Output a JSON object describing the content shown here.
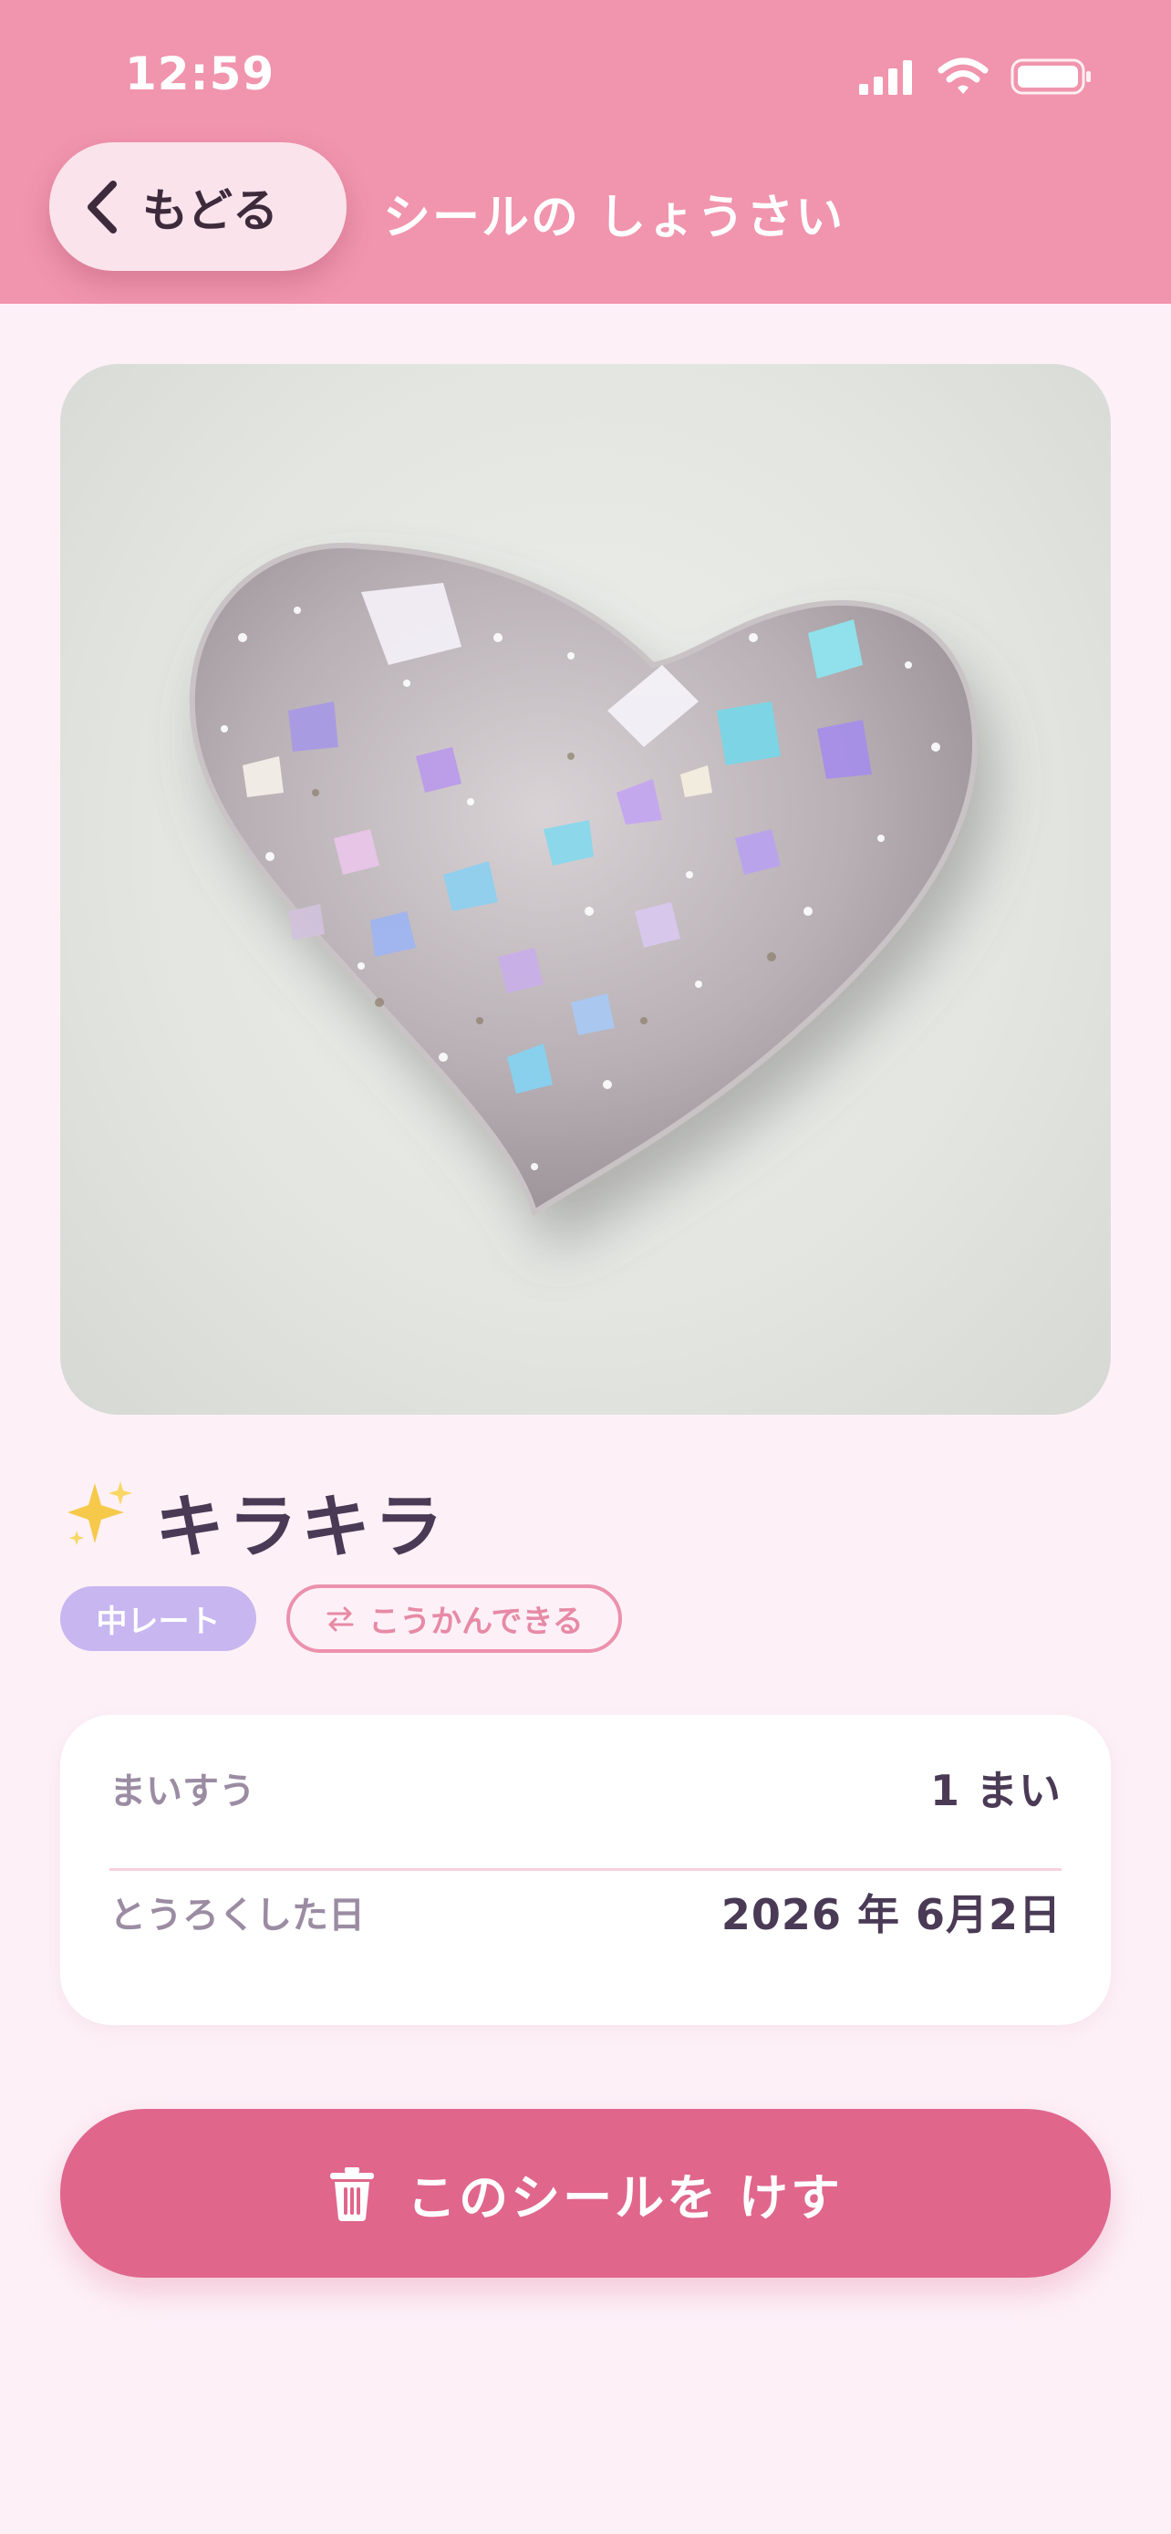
{
  "status_bar": {
    "time": "12:59"
  },
  "header": {
    "back_label": "もどる",
    "title": "シールの しょうさい"
  },
  "sticker": {
    "name": "キラキラ",
    "rarity": "中レート",
    "trade_status": "こうかんできる",
    "image_icon": "glitter-heart-sticker"
  },
  "details": {
    "rows": [
      {
        "label": "まいすう",
        "value": "1 まい"
      },
      {
        "label": "とうろくした日",
        "value": "2026 年 6月2日"
      }
    ]
  },
  "actions": {
    "delete_label": "このシールを けす"
  },
  "colors": {
    "header": "#f194ad",
    "background": "#fdf1f7",
    "accent": "#e0668c",
    "rarity_badge": "#c7b6f0",
    "text_primary": "#4a3a55",
    "text_secondary": "#9b8ca3"
  }
}
